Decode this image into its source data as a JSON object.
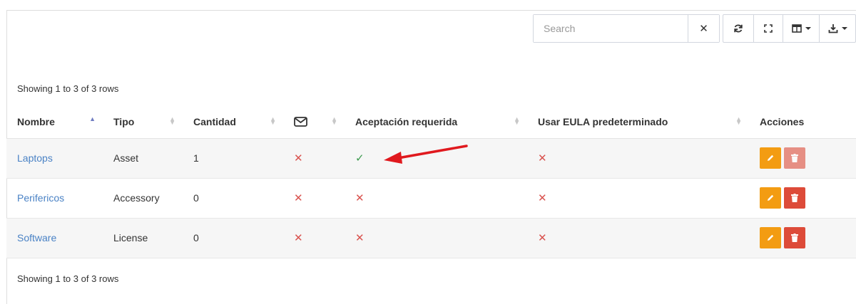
{
  "toolbar": {
    "search_placeholder": "Search",
    "clear_symbol": "✕"
  },
  "pagination": {
    "top": "Showing 1 to 3 of 3 rows",
    "bottom": "Showing 1 to 3 of 3 rows"
  },
  "table": {
    "headers": {
      "name": "Nombre",
      "type": "Tipo",
      "qty": "Cantidad",
      "email_icon": "envelope-icon",
      "acceptance": "Aceptación requerida",
      "eula": "Usar EULA predeterminado",
      "actions": "Acciones"
    },
    "sort_column": "name",
    "rows": [
      {
        "name": "Laptops",
        "type": "Asset",
        "qty": "1",
        "email": "✕",
        "acceptance": "✓",
        "eula": "✕",
        "delete_enabled": false
      },
      {
        "name": "Perifericos",
        "type": "Accessory",
        "qty": "0",
        "email": "✕",
        "acceptance": "✕",
        "eula": "✕",
        "delete_enabled": true
      },
      {
        "name": "Software",
        "type": "License",
        "qty": "0",
        "email": "✕",
        "acceptance": "✕",
        "eula": "✕",
        "delete_enabled": true
      }
    ]
  },
  "colors": {
    "link": "#4a82c5",
    "edit_button": "#f39c12",
    "delete_button": "#dd4b39",
    "annotation_arrow": "#e0191e",
    "check": "#3c9a4e",
    "cross": "#d9534f"
  },
  "icons": [
    "refresh-icon",
    "fullscreen-icon",
    "columns-icon",
    "export-icon",
    "pencil-icon",
    "trash-icon",
    "envelope-icon"
  ]
}
